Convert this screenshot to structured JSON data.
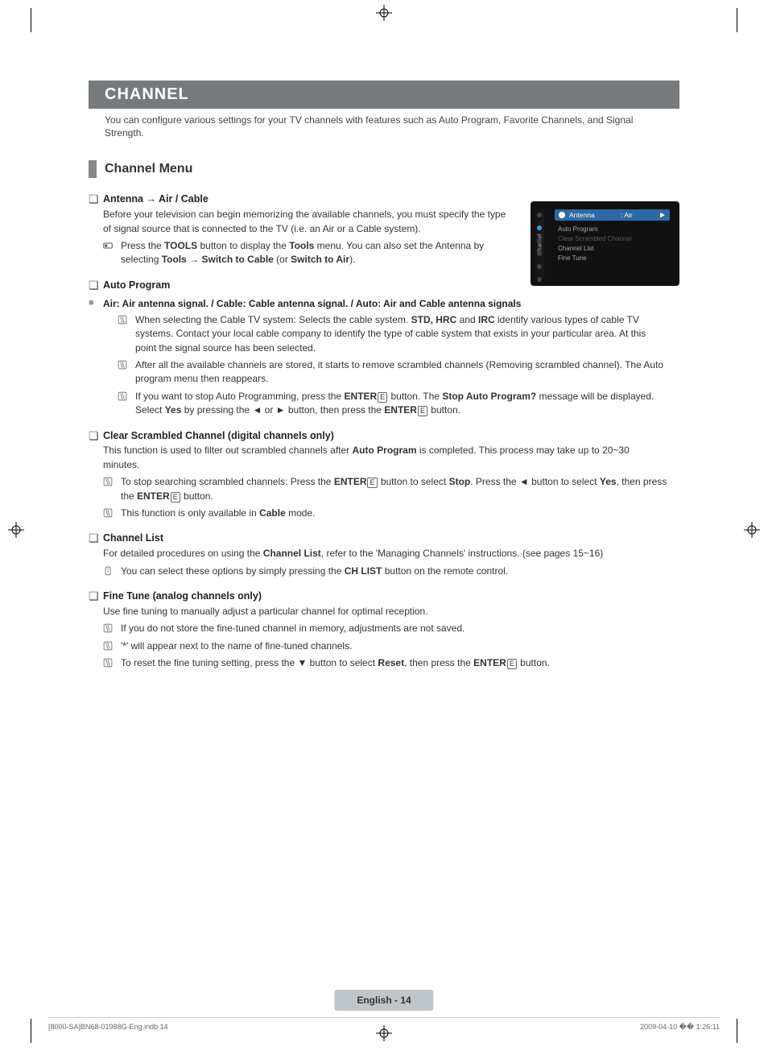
{
  "header": {
    "title": "CHANNEL"
  },
  "intro": "You can configure various settings for your TV channels with features such as Auto Program, Favorite Channels, and Signal Strength.",
  "section_title": "Channel Menu",
  "antenna": {
    "heading_prefix": "Antenna",
    "heading_arrow": "→",
    "heading_suffix": "Air / Cable",
    "body": "Before your television can begin memorizing the available channels, you must specify the type of signal source that is connected to the TV (i.e. an Air or a Cable system).",
    "note_pre": "Press the ",
    "note_bold1": "TOOLS",
    "note_mid": " button to display the ",
    "note_bold2": "Tools",
    "note_post1": " menu. You can also set the Antenna by selecting ",
    "note_bold3": "Tools",
    "note_arrow": " → ",
    "note_bold4": "Switch to Cable",
    "note_post2": " (or ",
    "note_bold5": "Switch to Air",
    "note_post3": ")."
  },
  "autoprog": {
    "heading": "Auto Program",
    "sig_heading": "Air: Air antenna signal. / Cable: Cable antenna signal. / Auto: Air and Cable antenna signals",
    "n1_pre": "When selecting the Cable TV system: Selects the cable system. ",
    "n1_bold1": "STD, HRC",
    "n1_mid": " and ",
    "n1_bold2": "IRC",
    "n1_post": " identify various types of cable TV systems. Contact your local cable company to identify the type of cable system that exists in your particular area. At this point the signal source has been selected.",
    "n2": "After all the available channels are stored, it starts to remove scrambled channels (Removing scrambled channel). The Auto program menu then reappears.",
    "n3_pre": "If you want to stop Auto Programming, press the ",
    "n3_bold1": "ENTER",
    "n3_mid1": " button. The ",
    "n3_bold2": "Stop Auto Program?",
    "n3_mid2": " message will be displayed. Select ",
    "n3_bold3": "Yes",
    "n3_mid3": " by pressing the ◄ or ► button, then press the ",
    "n3_bold4": "ENTER",
    "n3_post": " button."
  },
  "clearscr": {
    "heading": "Clear Scrambled Channel (digital channels only)",
    "body_pre": "This function is used to filter out scrambled channels after ",
    "body_bold": "Auto Program",
    "body_post": " is completed. This process may take up to 20~30 minutes.",
    "n1_pre": "To stop searching scrambled channels: Press the ",
    "n1_b1": "ENTER",
    "n1_mid1": " button to select ",
    "n1_b2": "Stop",
    "n1_mid2": ". Press the ◄ button to select ",
    "n1_b3": "Yes",
    "n1_mid3": ", then press the ",
    "n1_b4": "ENTER",
    "n1_post": " button.",
    "n2_pre": "This function is only available in ",
    "n2_bold": "Cable",
    "n2_post": " mode."
  },
  "chlist": {
    "heading": "Channel List",
    "body_pre": "For detailed procedures on using the ",
    "body_bold": "Channel List",
    "body_post": ", refer to the 'Managing Channels' instructions. (see pages 15~16)",
    "n1_pre": "You can select these options by simply pressing the ",
    "n1_bold": "CH LIST",
    "n1_post": " button on the remote control."
  },
  "finetune": {
    "heading": "Fine Tune (analog channels only)",
    "body": "Use fine tuning to manually adjust a particular channel for optimal reception.",
    "n1": "If you do not store the fine-tuned channel in memory, adjustments are not saved.",
    "n2": "'*' will appear next to the name of fine-tuned channels.",
    "n3_pre": "To reset the fine tuning setting, press the ▼ button to select ",
    "n3_bold1": "Reset",
    "n3_mid": ", then press the ",
    "n3_bold2": "ENTER",
    "n3_post": " button."
  },
  "osd": {
    "tab_label": "Channel",
    "antenna_label": "Antenna",
    "antenna_value": ": Air",
    "chevron": "►",
    "items": {
      "0": "Auto Program",
      "1": "Clear Scrambled Channel",
      "2": "Channel List",
      "3": "Fine Tune"
    }
  },
  "pagepill": "English - 14",
  "footer": {
    "left": "[8000-SA]BN68-01988G-Eng.indb   14",
    "right": "2009-04-10   �� 1:26:11"
  },
  "glyphs": {
    "square": "❏",
    "small_square": "■",
    "enter": "E",
    "remote": "O",
    "tools_icon": "T",
    "note_icon": "N"
  }
}
